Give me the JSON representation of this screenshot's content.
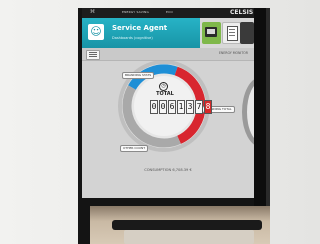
{
  "status_strip": {
    "left_text": "ENERGY SAVING",
    "mid_text": "ECO",
    "code": "CELSIS"
  },
  "agent": {
    "title": "Service Agent",
    "subtitle": "Dashboards (cognitive)",
    "icon": "agent-icon"
  },
  "subbar": {
    "menu_icon": "hamburger-menu-icon",
    "right_text": "ENERGY MONITOR"
  },
  "gauge": {
    "total_label": "TOTAL",
    "total_value": "0061378",
    "digits": [
      "0",
      "0",
      "6",
      "1",
      "3",
      "7",
      "8"
    ],
    "segments": [
      {
        "name": "blue",
        "color": "#1e8fd6",
        "share": 0.22
      },
      {
        "name": "red",
        "color": "#d8262f",
        "share": 0.38
      },
      {
        "name": "grey",
        "color": "#a9a9a9",
        "share": 0.4
      }
    ],
    "callouts": {
      "top_left": "BRANDING STATS",
      "right": "BRANDING TOTAL",
      "bottom_left": "OTHER COUNT"
    },
    "footer": "CONSUMPTION 6,708.39 €"
  },
  "colors": {
    "teal": "#1894a6",
    "green": "#7fb84a",
    "screen_bg": "#d3d3d3"
  }
}
